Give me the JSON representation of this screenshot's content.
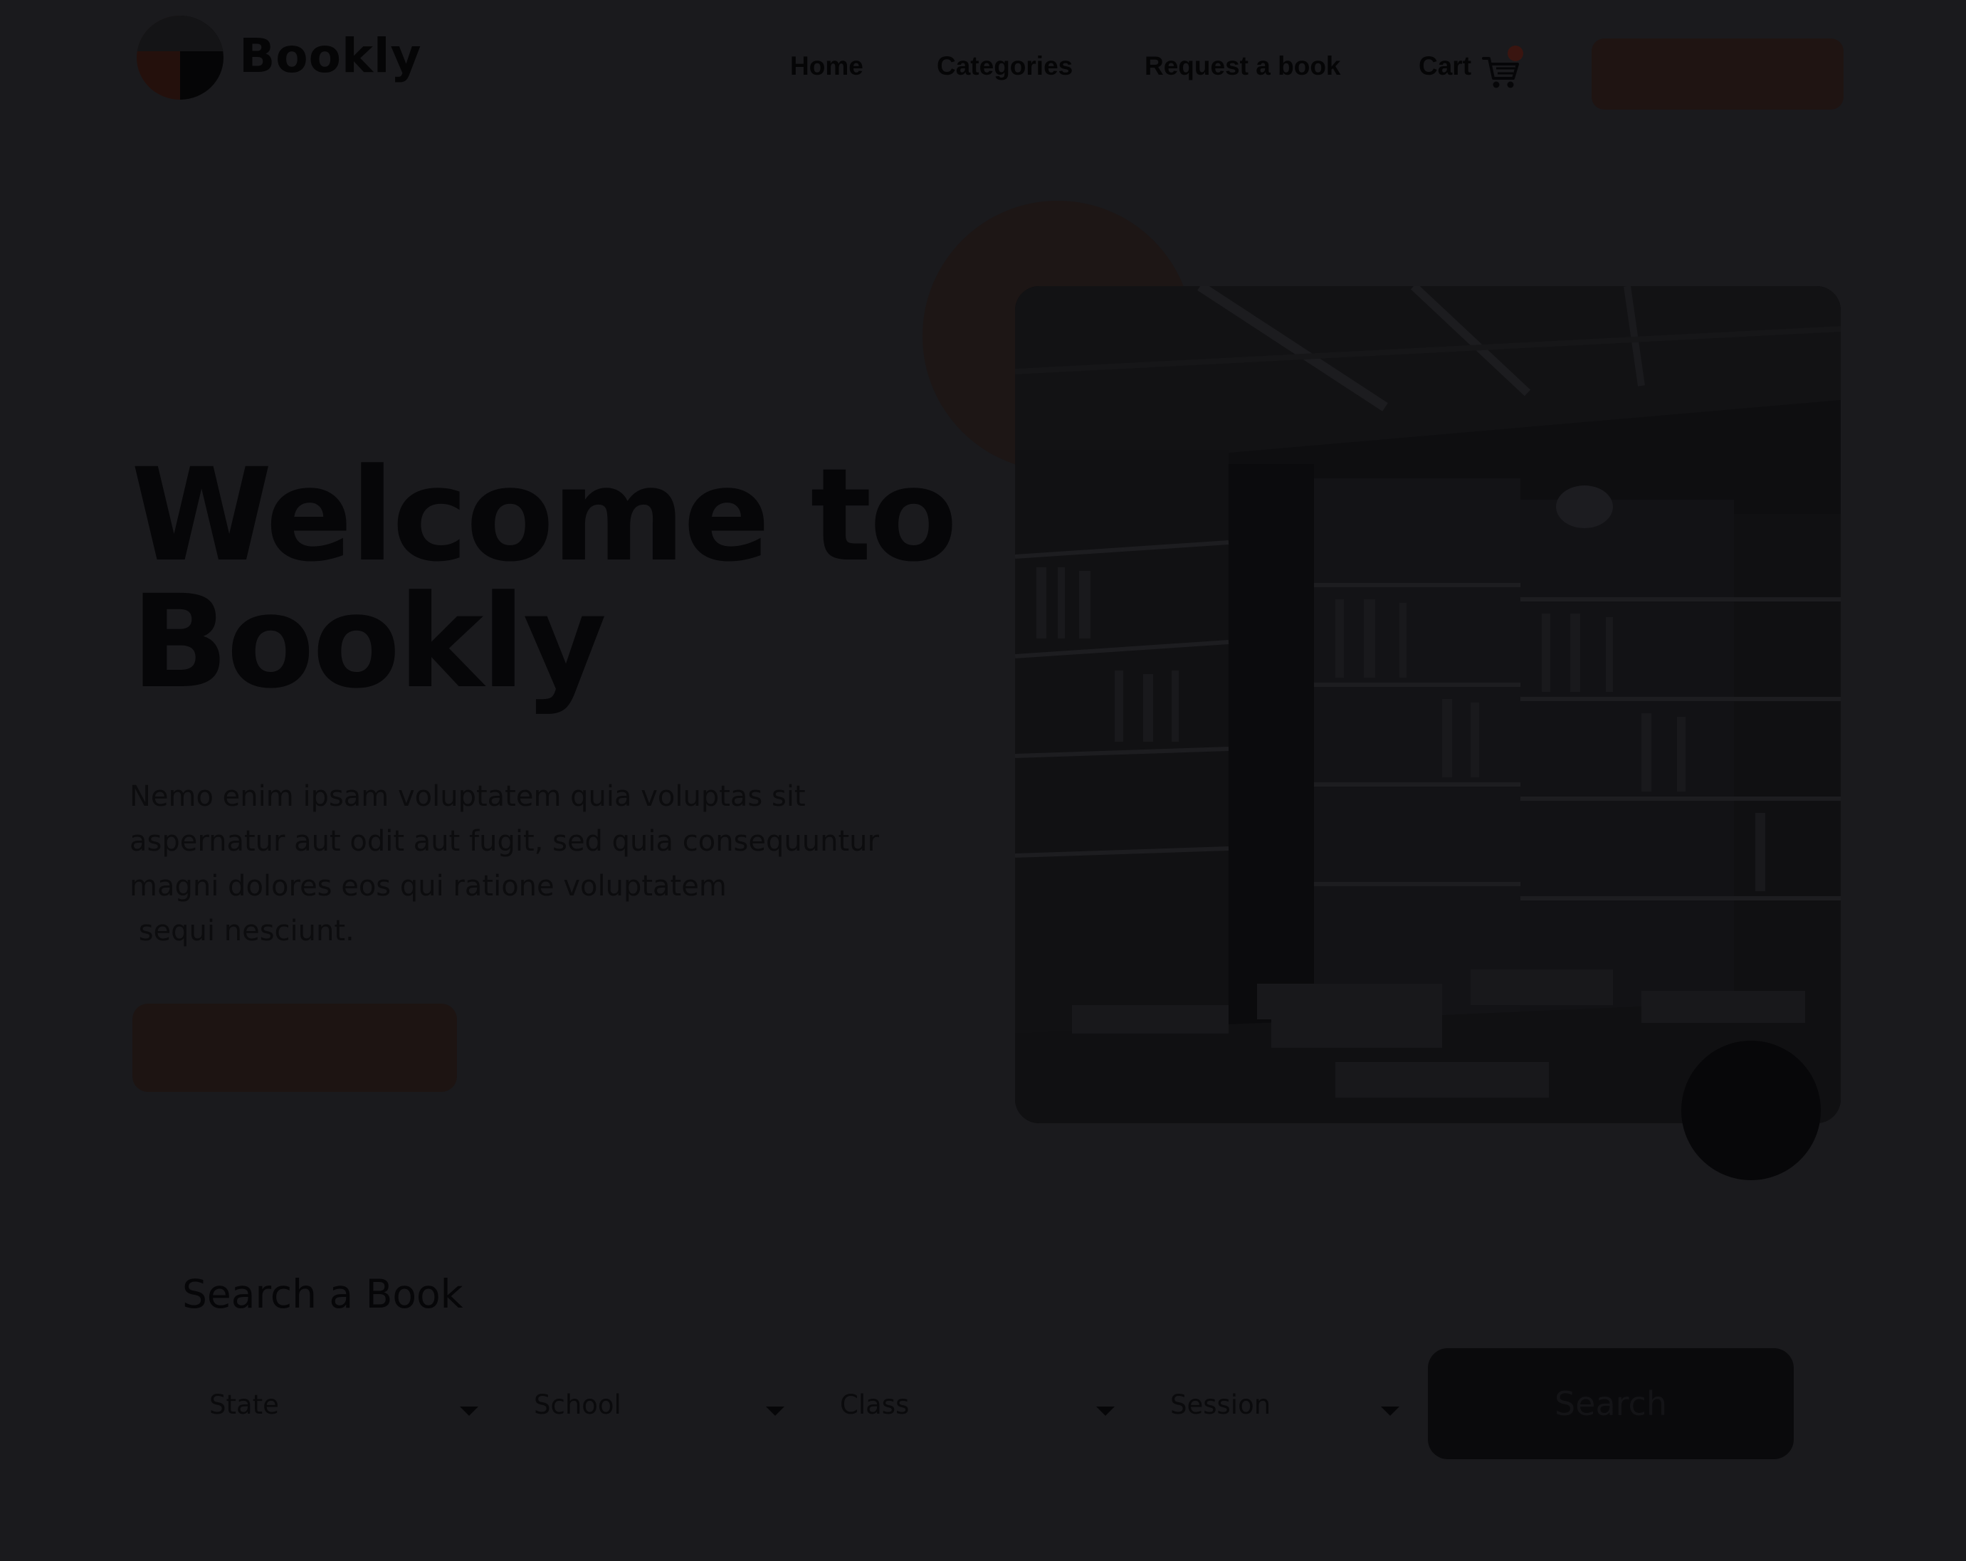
{
  "header": {
    "brand": "Bookly",
    "nav": [
      {
        "label": "Home"
      },
      {
        "label": "Categories"
      },
      {
        "label": "Request a book"
      },
      {
        "label": "Cart"
      }
    ],
    "cart_icon": "cart-icon"
  },
  "hero": {
    "title_line1": "Welcome to",
    "title_line2": "Bookly",
    "text_line1": "Nemo enim ipsam voluptatem quia voluptas sit",
    "text_line2": "aspernatur aut odit aut fugit, sed quia consequuntur",
    "text_line3": "magni dolores eos qui ratione voluptatem",
    "text_line4": " sequi nesciunt."
  },
  "search": {
    "title": "Search a Book",
    "fields": [
      {
        "label": "State"
      },
      {
        "label": "School"
      },
      {
        "label": "Class"
      },
      {
        "label": "Session"
      }
    ],
    "button_label": "Search"
  },
  "colors": {
    "overlay": "#1a1a1d",
    "accent_dim": "#1f1412",
    "button_dark": "#0a0a0c"
  }
}
